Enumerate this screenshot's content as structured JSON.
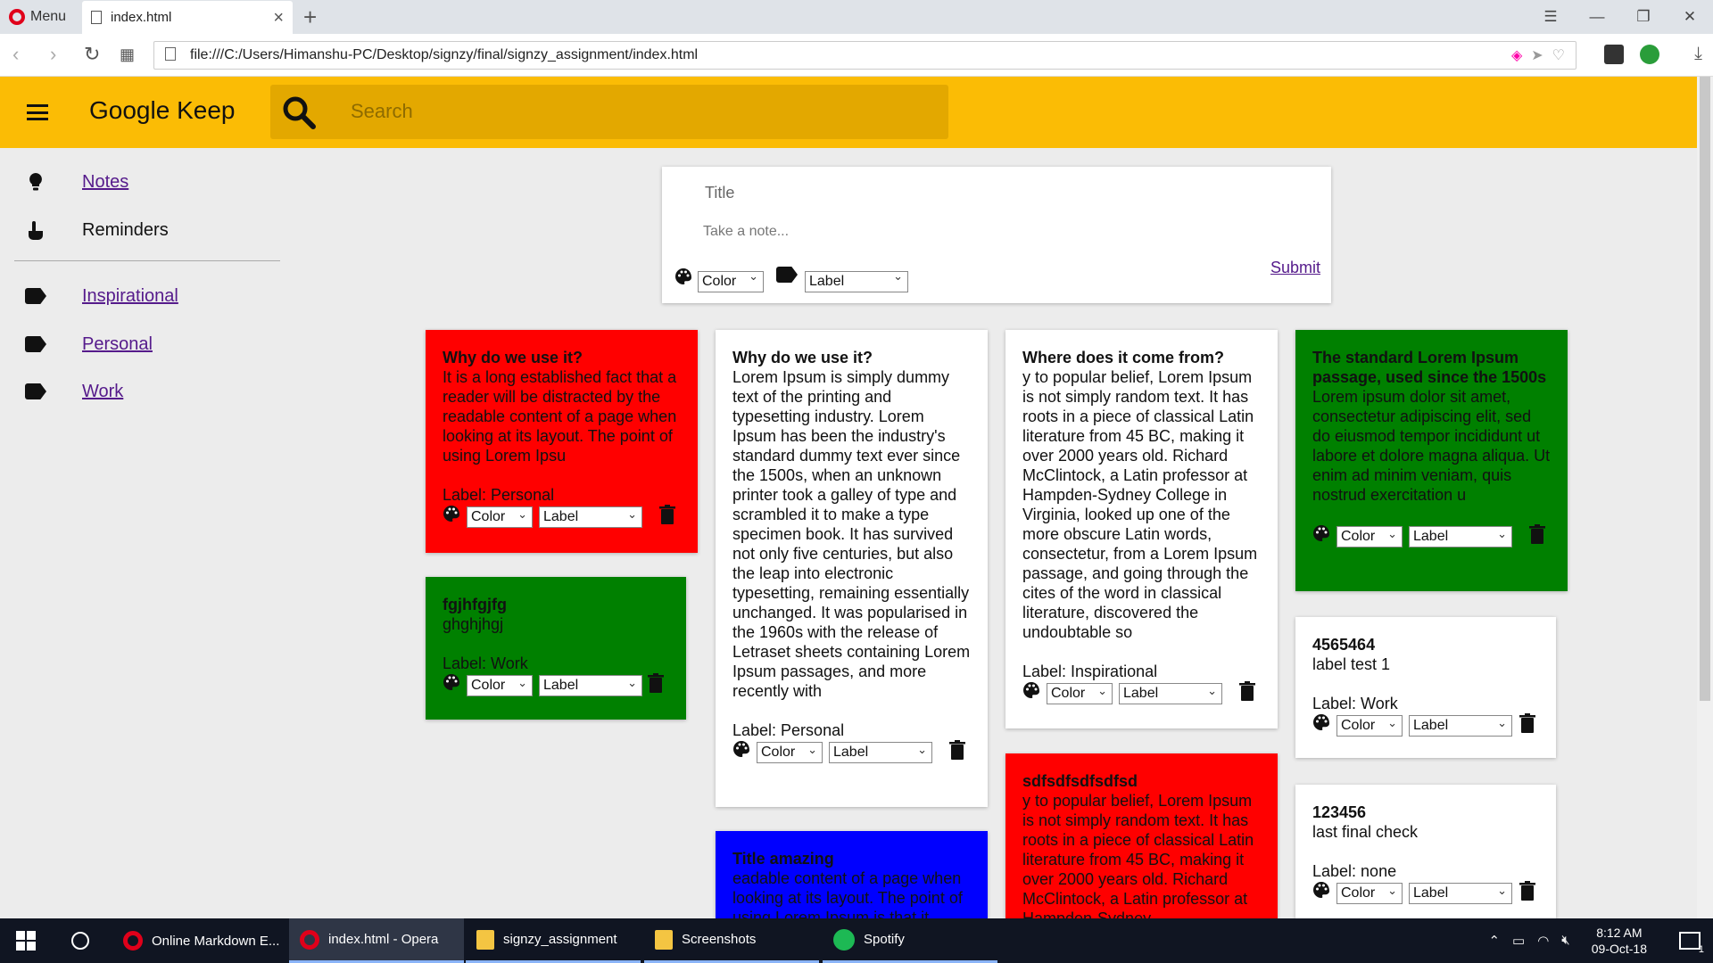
{
  "browser": {
    "menu_label": "Menu",
    "tab_title": "index.html",
    "url": "file:///C:/Users/Himanshu-PC/Desktop/signzy/final/signzy_assignment/index.html"
  },
  "app": {
    "logo": "Google Keep",
    "search_placeholder": "Search"
  },
  "sidebar": {
    "items": [
      {
        "label": "Notes",
        "icon": "lightbulb-icon",
        "link": true
      },
      {
        "label": "Reminders",
        "icon": "reminder-hand-icon",
        "link": false
      }
    ],
    "labels": [
      {
        "label": "Inspirational",
        "icon": "label-tag-icon"
      },
      {
        "label": "Personal",
        "icon": "label-tag-icon"
      },
      {
        "label": "Work",
        "icon": "label-tag-icon"
      }
    ]
  },
  "composer": {
    "title_placeholder": "Title",
    "note_placeholder": "Take a note...",
    "color_select": "Color",
    "label_select": "Label",
    "submit": "Submit"
  },
  "notes": [
    {
      "title": "Why do we use it?",
      "body": "It is a long established fact that a reader will be distracted by the readable content of a page when looking at its layout. The point of using Lorem Ipsu",
      "label": "Label: Personal",
      "color": "#ff0000",
      "color_select": "Color",
      "label_select": "Label"
    },
    {
      "title": "fgjhfgjfg",
      "body": "ghghjhgj",
      "label": "Label: Work",
      "color": "#008000",
      "color_select": "Color",
      "label_select": "Label"
    },
    {
      "title": "Why do we use it?",
      "body": "Lorem Ipsum is simply dummy text of the printing and typesetting industry. Lorem Ipsum has been the industry's standard dummy text ever since the 1500s, when an unknown printer took a galley of type and scrambled it to make a type specimen book. It has survived not only five centuries, but also the leap into electronic typesetting, remaining essentially unchanged. It was popularised in the 1960s with the release of Letraset sheets containing Lorem Ipsum passages, and more recently with",
      "label": "Label: Personal",
      "color": "#ffffff",
      "color_select": "Color",
      "label_select": "Label"
    },
    {
      "title": "Title amazing",
      "body": "eadable content of a page when looking at its layout. The point of using Lorem Ipsum is that it",
      "label": "",
      "color": "#0000ff",
      "color_select": "Color",
      "label_select": "Label"
    },
    {
      "title": "Where does it come from?",
      "body": "y to popular belief, Lorem Ipsum is not simply random text. It has roots in a piece of classical Latin literature from 45 BC, making it over 2000 years old. Richard McClintock, a Latin professor at Hampden-Sydney College in Virginia, looked up one of the more obscure Latin words, consectetur, from a Lorem Ipsum passage, and going through the cites of the word in classical literature, discovered the undoubtable so",
      "label": "Label: Inspirational",
      "color": "#ffffff",
      "color_select": "Color",
      "label_select": "Label"
    },
    {
      "title": "sdfsdfsdfsdfsd",
      "body": "y to popular belief, Lorem Ipsum is not simply random text. It has roots in a piece of classical Latin literature from 45 BC, making it over 2000 years old. Richard McClintock, a Latin professor at Hampden-Sydney",
      "label": "",
      "color": "#ff0000",
      "color_select": "Color",
      "label_select": "Label"
    },
    {
      "title": "The standard Lorem Ipsum passage, used since the 1500s",
      "body": "Lorem ipsum dolor sit amet, consectetur adipiscing elit, sed do eiusmod tempor incididunt ut labore et dolore magna aliqua. Ut enim ad minim veniam, quis nostrud exercitation u",
      "label": "",
      "color": "#008000",
      "color_select": "Color",
      "label_select": "Label"
    },
    {
      "title": "4565464",
      "body": "label test 1",
      "label": "Label: Work",
      "color": "#ffffff",
      "color_select": "Color",
      "label_select": "Label"
    },
    {
      "title": "123456",
      "body": "last final check",
      "label": "Label: none",
      "color": "#ffffff",
      "color_select": "Color",
      "label_select": "Label"
    }
  ],
  "taskbar": {
    "items": [
      {
        "label": "Online Markdown E...",
        "icon": "opera-icon"
      },
      {
        "label": "index.html - Opera",
        "icon": "opera-icon"
      },
      {
        "label": "signzy_assignment",
        "icon": "folder-icon"
      },
      {
        "label": "Screenshots",
        "icon": "folder-icon"
      },
      {
        "label": "Spotify",
        "icon": "spotify-icon"
      }
    ],
    "time": "8:12 AM",
    "date": "09-Oct-18",
    "notification_count": "1"
  }
}
